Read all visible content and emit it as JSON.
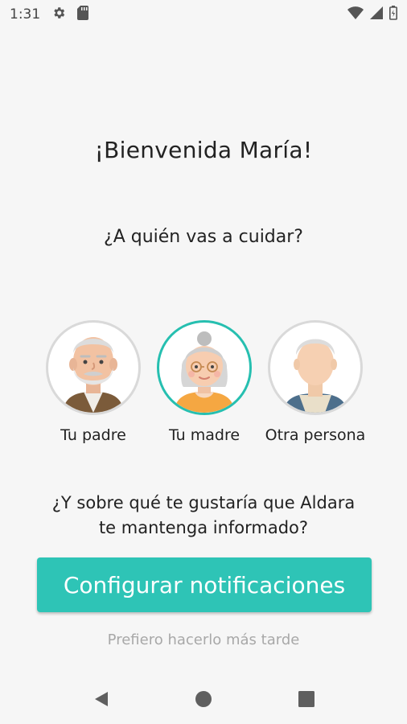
{
  "status_bar": {
    "time": "1:31"
  },
  "welcome": {
    "title": "¡Bienvenida María!"
  },
  "care": {
    "question": "¿A quién vas a cuidar?",
    "options": [
      {
        "label": "Tu padre",
        "selected": false
      },
      {
        "label": "Tu madre",
        "selected": true
      },
      {
        "label": "Otra persona",
        "selected": false
      }
    ]
  },
  "notifications": {
    "question_line1": "¿Y sobre qué te gustaría que Aldara",
    "question_line2": "te mantenga informado?",
    "configure_button": "Configurar notificaciones",
    "later_link": "Prefiero hacerlo más tarde"
  },
  "colors": {
    "accent": "#2ec4b6",
    "selected_ring": "#26bfb0"
  }
}
